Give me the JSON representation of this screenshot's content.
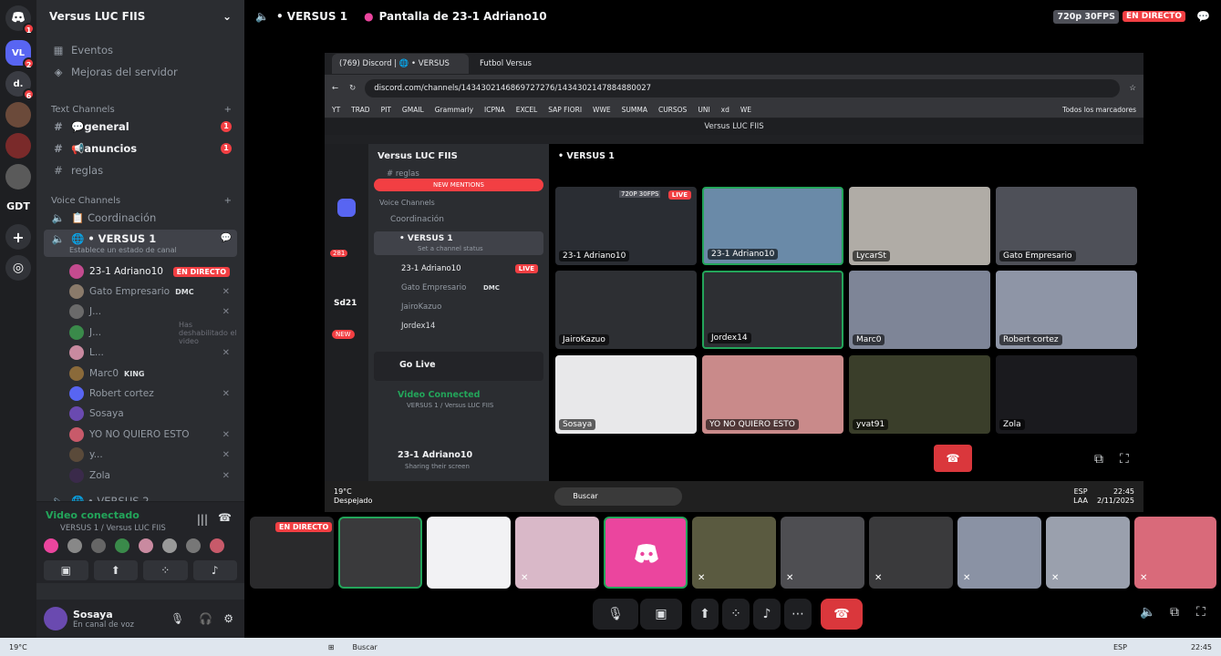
{
  "rail": {
    "servers": [
      {
        "label": "VL",
        "badge": "2",
        "color": "#5865f2"
      },
      {
        "label": "d.",
        "badge": "6",
        "color": "#3a3c43"
      },
      {
        "label": "",
        "badge": "",
        "color": "#6b4a3a"
      },
      {
        "label": "",
        "badge": "",
        "color": "#7a2a2a"
      },
      {
        "label": "",
        "badge": "",
        "color": "#5a5a5a"
      },
      {
        "label": "GDT",
        "badge": "",
        "color": "#1e1f22"
      }
    ],
    "home_badge": "1"
  },
  "sidebar": {
    "server_name": "Versus LUC FIIS",
    "events": "Eventos",
    "boosts": "Mejoras del servidor",
    "text_category": "Text Channels",
    "text_channels": [
      {
        "name": "💬general",
        "mentions": "1"
      },
      {
        "name": "📢anuncios",
        "mentions": "1"
      },
      {
        "name": "reglas",
        "mentions": ""
      }
    ],
    "voice_category": "Voice Channels",
    "voice_channels": [
      "📋 Coordinación",
      "🌐 • VERSUS 1",
      "🌐 • VERSUS 2"
    ],
    "channel_status": "Establece un estado de canal",
    "live_label": "EN DIRECTO",
    "video_hint": "Has deshabilitado el video",
    "voice_users": [
      {
        "name": "23-1 Adriano10",
        "tag": "",
        "color": "#c34b8f"
      },
      {
        "name": "Gato Empresario",
        "tag": "DMC",
        "color": "#8a7a6a"
      },
      {
        "name": "J...",
        "tag": "",
        "color": "#6a6a6a"
      },
      {
        "name": "J...",
        "tag": "",
        "color": "#3a8a4a"
      },
      {
        "name": "L...",
        "tag": "",
        "color": "#c98aa0"
      },
      {
        "name": "Marc0",
        "tag": "KING",
        "color": "#8a6a3a"
      },
      {
        "name": "Robert cortez",
        "tag": "",
        "color": "#5865f2"
      },
      {
        "name": "Sosaya",
        "tag": "",
        "color": "#6a4ab0"
      },
      {
        "name": "YO NO QUIERO ESTO",
        "tag": "",
        "color": "#c85a6a"
      },
      {
        "name": "y...",
        "tag": "",
        "color": "#5a4a3a"
      },
      {
        "name": "Zola",
        "tag": "",
        "color": "#3a2a4a"
      }
    ]
  },
  "voice_panel": {
    "status": "Video conectado",
    "channel": "VERSUS 1 / Versus LUC FIIS"
  },
  "user_panel": {
    "username": "Sosaya",
    "status": "En canal de voz"
  },
  "topbar": {
    "channel": "• VERSUS 1",
    "screen_title": "Pantalla de 23-1 Adriano10",
    "quality": "720p 30FPS",
    "live": "EN DIRECTO"
  },
  "shared_screen": {
    "tab1": "(769) Discord | 🌐 • VERSUS",
    "tab2": "Futbol Versus",
    "url": "discord.com/channels/1434302146869727276/1434302147884880027",
    "bookmarks": [
      "YT",
      "TRAD",
      "PIT",
      "GMAIL",
      "Grammarly",
      "ICPNA",
      "EXCEL",
      "SAP FIORI",
      "WWE",
      "SUMMA",
      "CURSOS",
      "UNI",
      "xd",
      "WE"
    ],
    "all_bookmarks": "Todos los marcadores",
    "inner_window_title": "Versus LUC FIIS",
    "inner_server": "Versus LUC FIIS",
    "inner_channel": "• VERSUS 1",
    "new_mentions": "NEW MENTIONS",
    "inner_voice_category": "Voice Channels",
    "inner_coordinacion": "Coordinación",
    "inner_versus": "• VERSUS 1",
    "inner_status_hint": "Set a channel status",
    "inner_users": [
      "23-1 Adriano10",
      "Gato Empresario",
      "JairoKazuo",
      "Jordex14"
    ],
    "inner_live": "LIVE",
    "inner_dmc": "DMC",
    "inner_reglas": "reglas",
    "inner_servers": [
      "281",
      "Sd21",
      "NEW"
    ],
    "go_live": "Go Live",
    "video_connected": "Video Connected",
    "inner_voice_channel": "VERSUS 1 / Versus LUC FIIS",
    "inner_user": "23-1 Adriano10",
    "inner_user_status": "Sharing their screen",
    "tiles": [
      {
        "name": "23-1 Adriano10",
        "color": "#2a2d33",
        "badge": "720P 30FPS",
        "live": "LIVE"
      },
      {
        "name": "23-1 Adriano10",
        "color": "#6a8aa8"
      },
      {
        "name": "LycarSt",
        "color": "#b0aca6"
      },
      {
        "name": "Gato Empresario",
        "color": "#4e5058"
      },
      {
        "name": "JairoKazuo",
        "color": "#2d2f33"
      },
      {
        "name": "Jordex14",
        "color": "#2d2f33"
      },
      {
        "name": "Marc0",
        "color": "#7e8597"
      },
      {
        "name": "Robert cortez",
        "color": "#8e95a6"
      },
      {
        "name": "Sosaya",
        "color": "#e8e8ea"
      },
      {
        "name": "YO NO QUIERO ESTO",
        "color": "#c98a8a"
      },
      {
        "name": "yvat91",
        "color": "#3a3e2a"
      },
      {
        "name": "Zola",
        "color": "#1a1a1e"
      }
    ],
    "weather": "19°C",
    "weather_desc": "Despejado",
    "search": "Buscar",
    "lang": "ESP",
    "lang2": "LAA",
    "time": "22:45",
    "date": "2/11/2025"
  },
  "filmstrip": {
    "live_label": "EN DIRECTO",
    "tiles": [
      {
        "color": "#2a2a2c"
      },
      {
        "color": "#3a3a3c"
      },
      {
        "color": "#f2f2f4"
      },
      {
        "color": "#d9b8c8"
      },
      {
        "color": "#eb459e"
      },
      {
        "color": "#5a5a40"
      },
      {
        "color": "#4e4e52"
      },
      {
        "color": "#3a3a3c"
      },
      {
        "color": "#8a92a4"
      },
      {
        "color": "#9aa0ad"
      },
      {
        "color": "#d96a7a"
      }
    ]
  },
  "taskbar": {
    "temp": "19°C",
    "search": "Buscar",
    "lang": "ESP",
    "time": "22:45"
  }
}
